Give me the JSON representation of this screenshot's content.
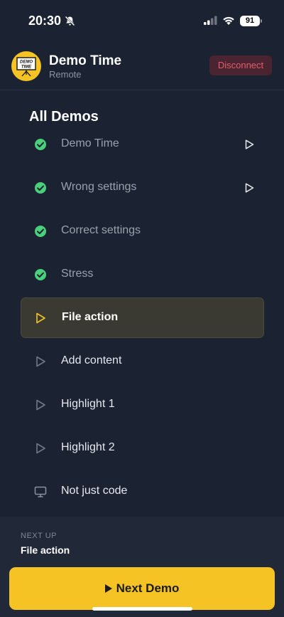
{
  "status_bar": {
    "time": "20:30",
    "battery": "91"
  },
  "header": {
    "app_name": "Demo Time",
    "subtitle": "Remote",
    "logo_text": "DEMO TIME",
    "disconnect_label": "Disconnect"
  },
  "list": {
    "title": "All Demos",
    "items": [
      {
        "label": "Demo Time",
        "status": "done",
        "icon": "check-circle-icon",
        "playable": true
      },
      {
        "label": "Wrong settings",
        "status": "done",
        "icon": "check-circle-icon",
        "playable": true
      },
      {
        "label": "Correct settings",
        "status": "done",
        "icon": "check-circle-icon",
        "playable": false
      },
      {
        "label": "Stress",
        "status": "done",
        "icon": "check-circle-icon",
        "playable": false
      },
      {
        "label": "File action",
        "status": "active",
        "icon": "play-outline-icon",
        "playable": false
      },
      {
        "label": "Add content",
        "status": "pending",
        "icon": "play-outline-icon",
        "playable": false
      },
      {
        "label": "Highlight 1",
        "status": "pending",
        "icon": "play-outline-icon",
        "playable": false
      },
      {
        "label": "Highlight 2",
        "status": "pending",
        "icon": "play-outline-icon",
        "playable": false
      },
      {
        "label": "Not just code",
        "status": "pending",
        "icon": "monitor-icon",
        "playable": false
      }
    ]
  },
  "footer": {
    "next_up_label": "NEXT UP",
    "next_up_value": "File action",
    "next_button_label": "Next Demo"
  },
  "colors": {
    "background": "#1b2332",
    "accent": "#f5c323",
    "done_green": "#4ad07a",
    "danger": "#e35d6a"
  }
}
